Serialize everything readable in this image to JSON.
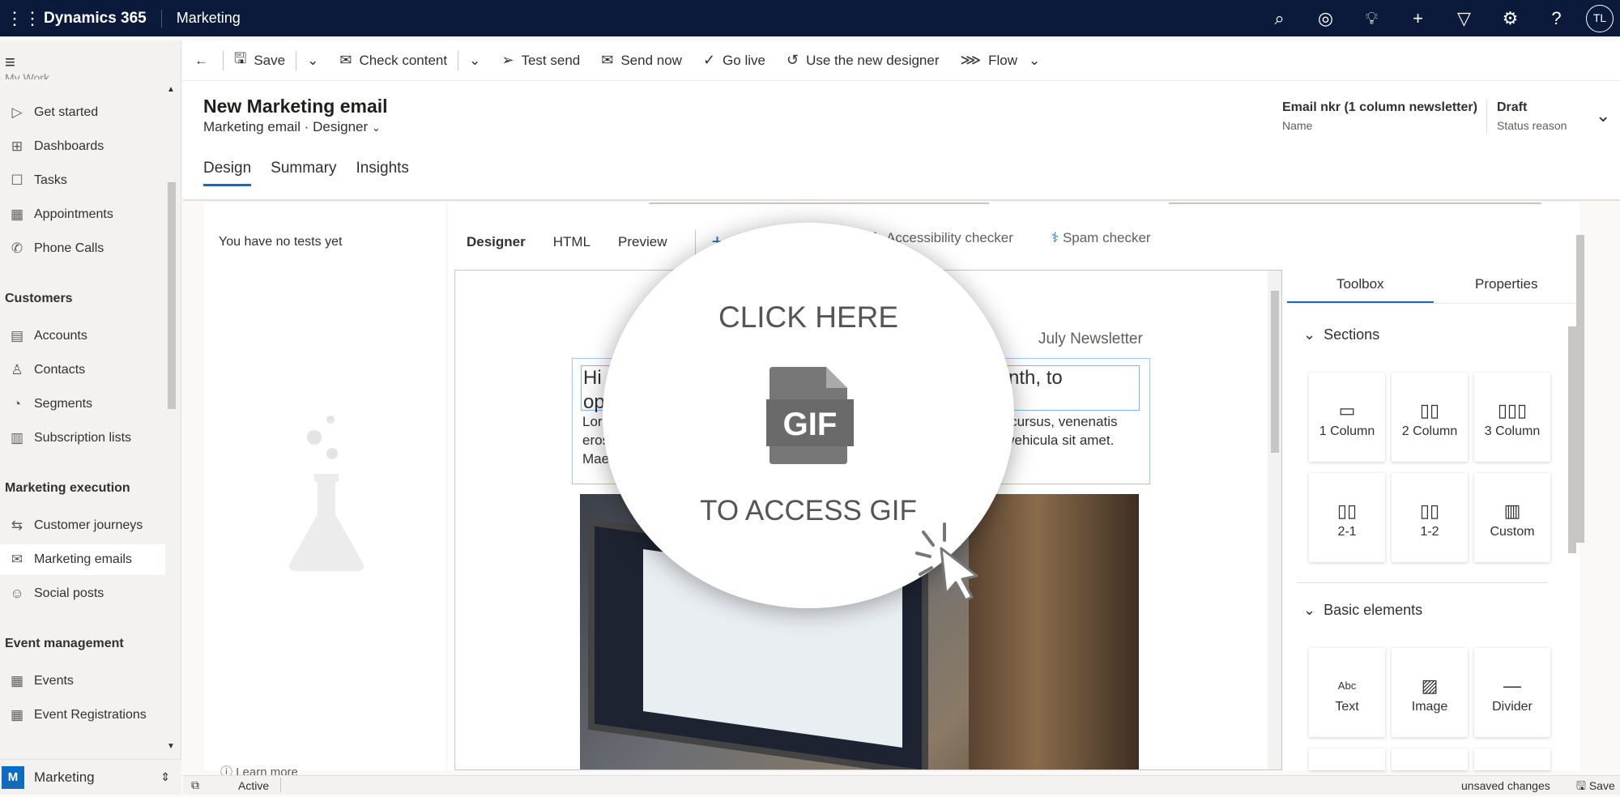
{
  "topbar": {
    "brand": "Dynamics 365",
    "app": "Marketing",
    "avatar": "TL",
    "icons": [
      "search-icon",
      "task-icon",
      "lightbulb-icon",
      "plus-icon",
      "filter-icon",
      "settings-icon",
      "help-icon"
    ]
  },
  "sidebar": {
    "cut_heading": "My Work",
    "items_top": [
      {
        "label": "Get started",
        "icon": "▷"
      },
      {
        "label": "Dashboards",
        "icon": "⊞"
      },
      {
        "label": "Tasks",
        "icon": "☐"
      },
      {
        "label": "Appointments",
        "icon": "▦"
      },
      {
        "label": "Phone Calls",
        "icon": "✆"
      }
    ],
    "group_customers": "Customers",
    "items_customers": [
      {
        "label": "Accounts",
        "icon": "▤"
      },
      {
        "label": "Contacts",
        "icon": "♙"
      },
      {
        "label": "Segments",
        "icon": "◔"
      },
      {
        "label": "Subscription lists",
        "icon": "▥"
      }
    ],
    "group_execution": "Marketing execution",
    "items_execution": [
      {
        "label": "Customer journeys",
        "icon": "⇆"
      },
      {
        "label": "Marketing emails",
        "icon": "✉"
      },
      {
        "label": "Social posts",
        "icon": "☺"
      }
    ],
    "group_events": "Event management",
    "items_events": [
      {
        "label": "Events",
        "icon": "▦"
      },
      {
        "label": "Event Registrations",
        "icon": "▦"
      }
    ],
    "area": {
      "letter": "M",
      "label": "Marketing"
    }
  },
  "commandbar": {
    "back": "←",
    "save": "Save",
    "check_content": "Check content",
    "test_send": "Test send",
    "send_now": "Send now",
    "go_live": "Go live",
    "use_new_designer": "Use the new designer",
    "flow": "Flow"
  },
  "header": {
    "title": "New Marketing email",
    "subtitle_entity": "Marketing email",
    "subtitle_form": "Designer",
    "name_value": "Email nkr (1 column newsletter)",
    "name_label": "Name",
    "status_value": "Draft",
    "status_label": "Status reason",
    "tabs": [
      "Design",
      "Summary",
      "Insights"
    ]
  },
  "leftpanel": {
    "empty": "You have no tests yet",
    "learn_more": "Learn more"
  },
  "designer": {
    "tabs": [
      "Designer",
      "HTML",
      "Preview"
    ],
    "accessibility": "Accessibility checker",
    "spam": "Spam checker",
    "newsletter_label": "July Newsletter",
    "heading_start": "Hi",
    "heading_end": "nth, to",
    "heading_line2": "op",
    "body_line1_start": "Lore",
    "body_line1_end": "e cursus, venenatis",
    "body_line2_start": "eros",
    "body_line2_end": "vehicula sit amet.",
    "body_line3_start": "Mae"
  },
  "toolbox": {
    "tabs": [
      "Toolbox",
      "Properties"
    ],
    "sections_title": "Sections",
    "sections": [
      {
        "label": "1 Column",
        "glyph": "▭"
      },
      {
        "label": "2 Column",
        "glyph": "▯▯"
      },
      {
        "label": "3 Column",
        "glyph": "▯▯▯"
      },
      {
        "label": "2-1",
        "glyph": "▯▯"
      },
      {
        "label": "1-2",
        "glyph": "▯▯"
      },
      {
        "label": "Custom",
        "glyph": "▥"
      }
    ],
    "basic_title": "Basic elements",
    "basic": [
      {
        "label": "Text",
        "glyph": "Abc"
      },
      {
        "label": "Image",
        "glyph": "▨"
      },
      {
        "label": "Divider",
        "glyph": "—"
      }
    ]
  },
  "statusbar": {
    "status": "Active",
    "unsaved": "unsaved changes",
    "save": "Save"
  },
  "overlay": {
    "top": "CLICK HERE",
    "bottom": "TO ACCESS GIF",
    "badge": "GIF"
  }
}
